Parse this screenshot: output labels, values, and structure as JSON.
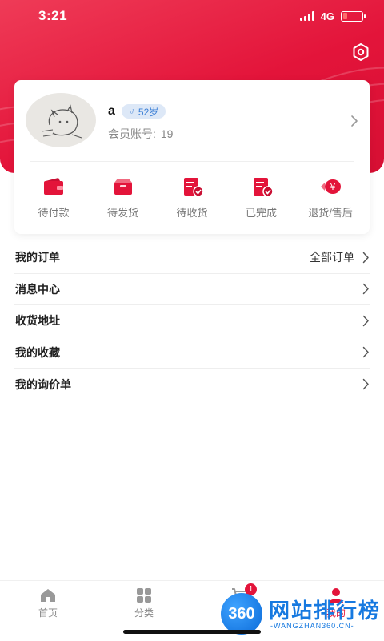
{
  "status_bar": {
    "time": "3:21",
    "network": "4G"
  },
  "profile": {
    "username": "a",
    "gender_symbol": "♂",
    "age": "52岁",
    "member_label": "会员账号:",
    "member_id": "19"
  },
  "orders": [
    {
      "label": "待付款",
      "icon": "wallet-icon"
    },
    {
      "label": "待发货",
      "icon": "package-icon"
    },
    {
      "label": "待收货",
      "icon": "receive-doc-icon"
    },
    {
      "label": "已完成",
      "icon": "completed-doc-icon"
    },
    {
      "label": "退货/售后",
      "icon": "refund-icon"
    }
  ],
  "menu": [
    {
      "label": "我的订单",
      "extra": "全部订单"
    },
    {
      "label": "消息中心"
    },
    {
      "label": "收货地址"
    },
    {
      "label": "我的收藏"
    },
    {
      "label": "我的询价单"
    }
  ],
  "tabbar": {
    "items": [
      {
        "label": "首页",
        "icon": "home-icon"
      },
      {
        "label": "分类",
        "icon": "grid-icon"
      },
      {
        "label": "",
        "icon": "cart-icon",
        "badge": "1"
      },
      {
        "label": "我的",
        "icon": "user-icon"
      }
    ]
  },
  "watermark": {
    "logo_text": "360",
    "title": "网站排行榜",
    "subtitle": "-WANGZHAN360.CN-"
  },
  "colors": {
    "brand": "#e3143a",
    "badge_bg": "#dde8f7",
    "badge_text": "#3b7fd6"
  }
}
